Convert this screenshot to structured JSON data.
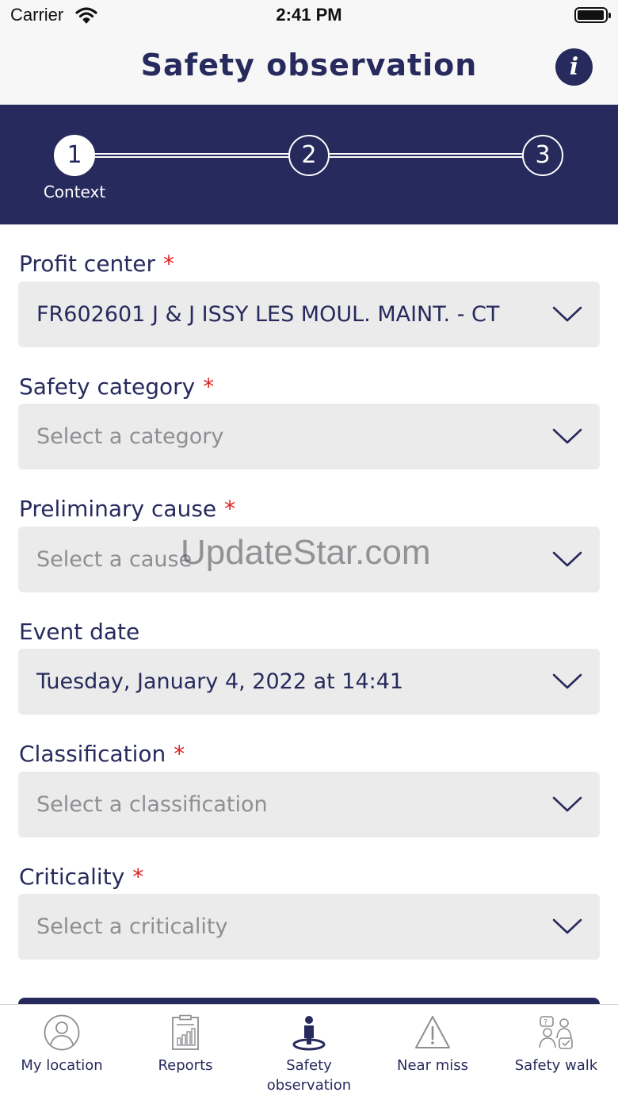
{
  "status_bar": {
    "carrier": "Carrier",
    "time": "2:41 PM"
  },
  "nav": {
    "title": "Safety observation",
    "info_icon": "info-icon"
  },
  "stepper": {
    "steps": [
      {
        "number": "1",
        "label": "Context",
        "active": true
      },
      {
        "number": "2",
        "label": "",
        "active": false
      },
      {
        "number": "3",
        "label": "",
        "active": false
      }
    ]
  },
  "form": {
    "required_marker": "*",
    "profit_center": {
      "label": "Profit center",
      "value": "FR602601 J & J ISSY LES MOUL. MAINT. - CT"
    },
    "safety_category": {
      "label": "Safety category",
      "placeholder": "Select a category"
    },
    "preliminary_cause": {
      "label": "Preliminary cause",
      "placeholder": "Select a cause"
    },
    "event_date": {
      "label": "Event date",
      "value": "Tuesday, January 4, 2022 at 14:41"
    },
    "classification": {
      "label": "Classification",
      "placeholder": "Select a classification"
    },
    "criticality": {
      "label": "Criticality",
      "placeholder": "Select a criticality"
    }
  },
  "watermark": "UpdateStar.com",
  "tab_bar": {
    "tabs": [
      {
        "label": "My location",
        "icon": "person-circle-icon",
        "active": false
      },
      {
        "label": "Reports",
        "icon": "report-chart-icon",
        "active": false
      },
      {
        "label": "Safety observation",
        "icon": "safety-observation-icon",
        "active": true
      },
      {
        "label": "Near miss",
        "icon": "warning-triangle-icon",
        "active": false
      },
      {
        "label": "Safety walk",
        "icon": "safety-walk-icon",
        "active": false
      }
    ]
  },
  "colors": {
    "primary": "#272a5c",
    "required": "#e02020",
    "field_bg": "#ebebeb",
    "placeholder": "#8e8e93"
  }
}
